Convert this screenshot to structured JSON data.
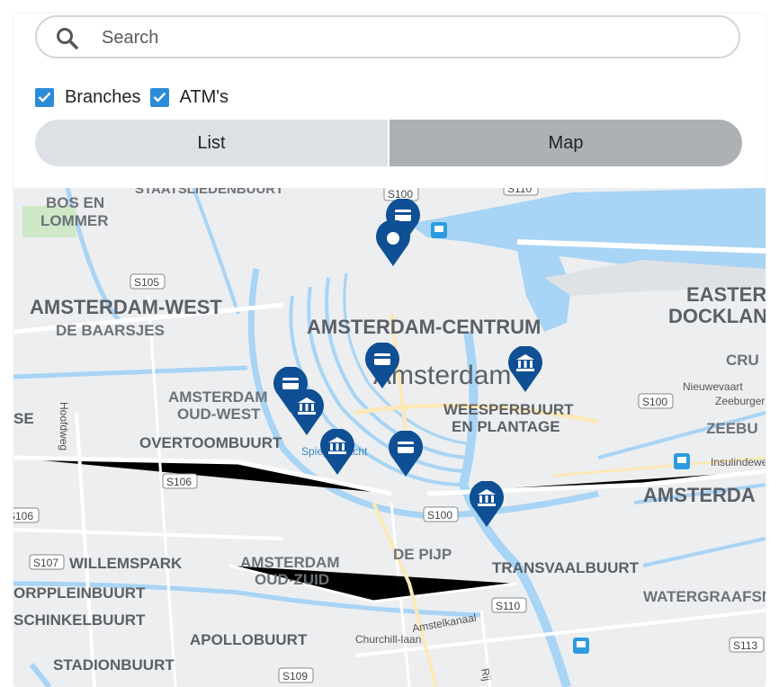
{
  "search": {
    "placeholder": "Search",
    "value": ""
  },
  "filters": [
    {
      "label": "Branches",
      "checked": true
    },
    {
      "label": "ATM's",
      "checked": true
    }
  ],
  "view_toggle": {
    "list_label": "List",
    "map_label": "Map",
    "selected": "Map"
  },
  "map": {
    "districts": [
      "BOS EN",
      "LOMMER",
      "STAATSLIEDENBUURT",
      "AMSTERDAM-WEST",
      "DE BAARSJES",
      "AMSTERDAM-CENTRUM",
      "Amsterdam",
      "EASTERN",
      "DOCKLANDS",
      "CRU",
      "AMSTERDAM",
      "OUD-WEST",
      "WEESPERBUURT",
      "EN PLANTAGE",
      "ZEEBU",
      "OVERTOOMBUURT",
      "Spiegelgracht",
      "AMSTERDA",
      "WILLEMSPARK",
      "AMSTERDAM",
      "OUD-ZUID",
      "DE PIJP",
      "TRANSVAALBUURT",
      "ORPPLEINBUURT",
      "WATERGRAAFSM",
      "SCHINKELBUURT",
      "APOLLOBUURT",
      "STADIONBUURT",
      "SE"
    ],
    "road_labels": [
      "S100",
      "S110",
      "S105",
      "S100",
      "S106",
      "S106",
      "S100",
      "S107",
      "S110",
      "S113",
      "S109"
    ],
    "street_labels": [
      "Nieuwevaart",
      "Zeeburger",
      "Insulindewe",
      "Hoofdweg",
      "Amstelkanaal",
      "Churchill-laan",
      "Rij"
    ],
    "markers": [
      {
        "type": "atm",
        "icon": "credit-card-icon"
      },
      {
        "type": "location",
        "icon": "location-dot-icon"
      },
      {
        "type": "atm",
        "icon": "credit-card-icon"
      },
      {
        "type": "branch",
        "icon": "bank-icon"
      },
      {
        "type": "atm",
        "icon": "credit-card-icon"
      },
      {
        "type": "branch",
        "icon": "bank-icon"
      },
      {
        "type": "branch",
        "icon": "bank-icon"
      },
      {
        "type": "atm",
        "icon": "credit-card-icon"
      },
      {
        "type": "branch",
        "icon": "bank-icon"
      }
    ],
    "colors": {
      "water": "#a8d4f5",
      "land": "#eceef0",
      "marker": "#0f4f94",
      "checkbox": "#2d8cd8"
    }
  }
}
